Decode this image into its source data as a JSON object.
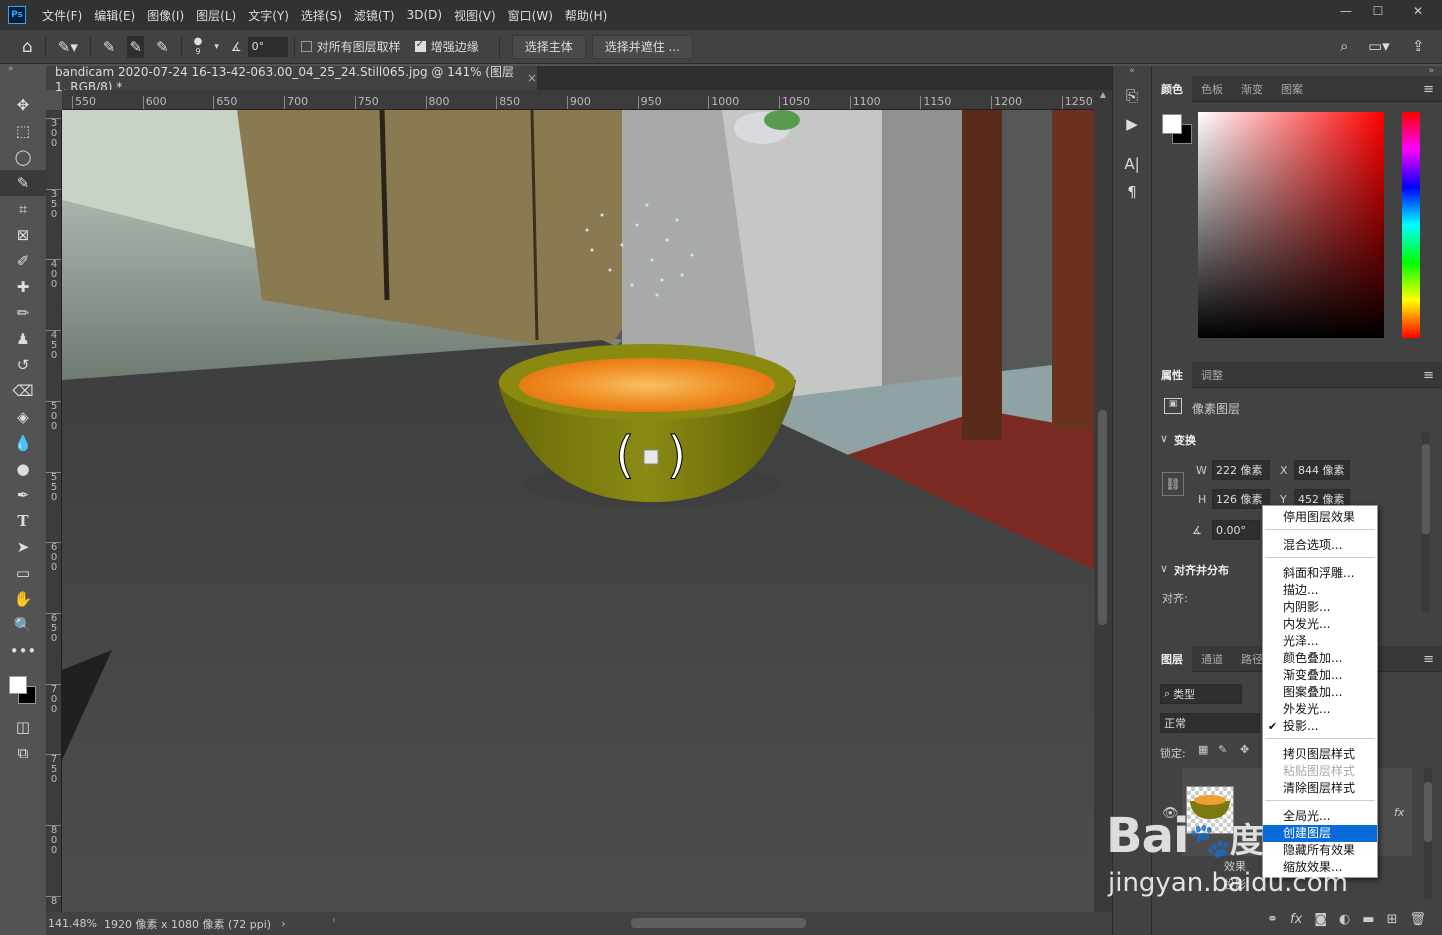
{
  "menubar": {
    "logo": "Ps",
    "items": [
      "文件(F)",
      "编辑(E)",
      "图像(I)",
      "图层(L)",
      "文字(Y)",
      "选择(S)",
      "滤镜(T)",
      "3D(D)",
      "视图(V)",
      "窗口(W)",
      "帮助(H)"
    ],
    "minimize": "—",
    "restore": "☐",
    "close": "✕"
  },
  "options": {
    "brush_size": "9",
    "angle": "0°",
    "sample_all_layers": "对所有图层取样",
    "sample_all_checked": false,
    "enhance_edge": "增强边缘",
    "enhance_edge_checked": true,
    "select_subject": "选择主体",
    "select_and_mask": "选择并遮住 ..."
  },
  "document": {
    "tab_title": "bandicam 2020-07-24 16-13-42-063.00_04_25_24.Still065.jpg @ 141% (图层 1, RGB/8) *",
    "close": "×"
  },
  "ruler_h": [
    "550",
    "600",
    "650",
    "700",
    "750",
    "800",
    "850",
    "900",
    "950",
    "1000",
    "1050",
    "1100",
    "1150",
    "1200",
    "1250"
  ],
  "ruler_v": [
    "300",
    "350",
    "400",
    "450",
    "500",
    "550",
    "600",
    "650",
    "700",
    "750",
    "800",
    "8"
  ],
  "status": {
    "zoom": "141.48%",
    "doc_info": "1920 像素 x 1080 像素 (72 ppi)",
    "arrow": "›"
  },
  "panels": {
    "color_tabs": [
      "颜色",
      "色板",
      "渐变",
      "图案"
    ],
    "properties_tabs": [
      "属性",
      "调整"
    ],
    "pixel_layer": "像素图层",
    "transform": "变换",
    "w_label": "W",
    "w_value": "222 像素",
    "x_label": "X",
    "x_value": "844 像素",
    "h_label": "H",
    "h_value": "126 像素",
    "y_label": "Y",
    "y_value": "452 像素",
    "angle_value": "0.00°",
    "align_distribute": "对齐并分布",
    "align_label": "对齐:",
    "layers_tabs": [
      "图层",
      "通道",
      "路径"
    ],
    "filter_kind": "类型",
    "blend_mode": "正常",
    "lock_label": "锁定:",
    "effect_label": "效果",
    "drop_shadow_label": "投影"
  },
  "context_menu": {
    "items": [
      {
        "label": "停用图层效果",
        "disabled": false
      },
      {
        "label": "混合选项...",
        "disabled": false
      },
      {
        "label": "斜面和浮雕...",
        "disabled": false
      },
      {
        "label": "描边...",
        "disabled": false
      },
      {
        "label": "内阴影...",
        "disabled": false
      },
      {
        "label": "内发光...",
        "disabled": false
      },
      {
        "label": "光泽...",
        "disabled": false
      },
      {
        "label": "颜色叠加...",
        "disabled": false
      },
      {
        "label": "渐变叠加...",
        "disabled": false
      },
      {
        "label": "图案叠加...",
        "disabled": false
      },
      {
        "label": "外发光...",
        "disabled": false
      },
      {
        "label": "投影...",
        "disabled": false,
        "checked": true
      },
      {
        "label": "拷贝图层样式",
        "disabled": false
      },
      {
        "label": "粘贴图层样式",
        "disabled": true
      },
      {
        "label": "清除图层样式",
        "disabled": false
      },
      {
        "label": "全局光...",
        "disabled": false
      },
      {
        "label": "创建图层",
        "disabled": false,
        "highlighted": true
      },
      {
        "label": "隐藏所有效果",
        "disabled": false
      },
      {
        "label": "缩放效果...",
        "disabled": false
      }
    ],
    "check_mark": "✔"
  },
  "watermark": {
    "brand": "Bai",
    "brand_suffix": "度",
    "url": "jingyan.baidu.com"
  },
  "colors": {
    "accent_highlight": "#0a6ad8",
    "bowl": "#7a7a10",
    "soup": "#f0a030"
  }
}
